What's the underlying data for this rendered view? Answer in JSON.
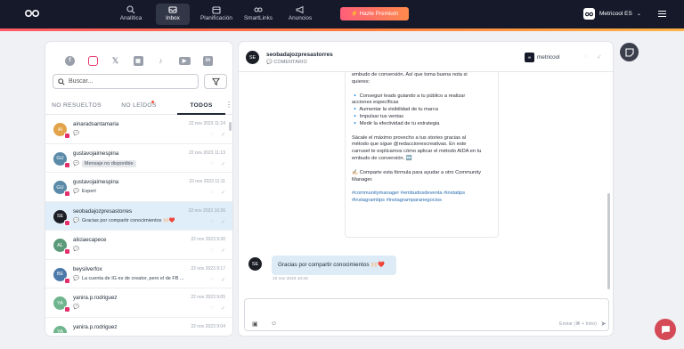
{
  "topbar": {
    "nav": [
      {
        "label": "Analítica",
        "icon": "search-chart-icon"
      },
      {
        "label": "Inbox",
        "icon": "inbox-icon"
      },
      {
        "label": "Planificación",
        "icon": "calendar-icon"
      },
      {
        "label": "SmartLinks",
        "icon": "link-icon"
      },
      {
        "label": "Anuncios",
        "icon": "megaphone-icon"
      }
    ],
    "premium_label": "Hazte Premium",
    "account_name": "Metricool ES"
  },
  "inbox": {
    "search_placeholder": "Buscar...",
    "tabs": [
      "NO RESUELTOS",
      "NO LEÍDOS",
      "TODOS"
    ],
    "conversations": [
      {
        "initials": "AI",
        "color": "#e2a34a",
        "user": "ainaradsantamaria",
        "date": "22 nov 2023 11:24",
        "preview": "",
        "tag": ""
      },
      {
        "initials": "GU",
        "color": "#5a8aa8",
        "user": "gustavojaimespina",
        "date": "22 nov 2023 11:13",
        "preview": "",
        "tag": "Mensaje no disponible"
      },
      {
        "initials": "GU",
        "color": "#5a8aa8",
        "user": "gustavojaimespina",
        "date": "22 nov 2023 11:11",
        "preview": "Expert",
        "tag": ""
      },
      {
        "initials": "SE",
        "color": "#1c1e26",
        "user": "seobadajozpresastorres",
        "date": "22 nov 2023 10:26",
        "preview": "Gracias por compartir conocimientos 🙌🏻❤️",
        "tag": ""
      },
      {
        "initials": "AL",
        "color": "#5b9a78",
        "user": "aliciaecapece",
        "date": "22 nov 2023 9:30",
        "preview": "",
        "tag": ""
      },
      {
        "initials": "BE",
        "color": "#4a78a8",
        "user": "beysilverfox",
        "date": "22 nov 2023 9:17",
        "preview": "La cuenta de IG es de creator, pero el de FB ...",
        "tag": ""
      },
      {
        "initials": "YA",
        "color": "#6fb58e",
        "user": "yanira.p.rodriguez",
        "date": "22 nov 2023 9:05",
        "preview": "",
        "tag": ""
      },
      {
        "initials": "YA",
        "color": "#6fb58e",
        "user": "yanira.p.rodriguez",
        "date": "22 nov 2023 9:04",
        "preview": "😄",
        "tag": ""
      }
    ]
  },
  "conversation": {
    "initials": "SE",
    "user": "seobadajozpresastorres",
    "type": "COMENTARIO",
    "account": "metricool",
    "post_lines": [
      "embudo de conversión. Así que toma buena nota si",
      "quieres:",
      "",
      "🔹 Conseguir leads guiando a tu público a realizar",
      "acciones específicas",
      "🔹 Aumentar la visibilidad de tu marca",
      "🔹 Impulsar tus ventas",
      "🔹 Medir la efectividad de tu estrategia",
      "",
      "Sácale el máximo provecho a tus stories gracias al",
      "método que sigue @redaccionescreativas. En este",
      "carrusel te explicamos cómo aplicar el método AIDA en tu",
      "embudo de conversión. ↔️",
      "",
      "✍🏻 Comparte esta fórmula para ayudar a otro Community",
      "Manager.",
      ""
    ],
    "hashtags_1": "#communitymanager #embudosdeventa #instatips",
    "hashtags_2": "#instagramtips #instagramparanegocios",
    "message_text": "Gracias por compartir conocimientos 🙌🏻❤️",
    "message_date": "22 nov 2023 10:26",
    "send_hint": "Enviar (⌘ + Intro)"
  }
}
